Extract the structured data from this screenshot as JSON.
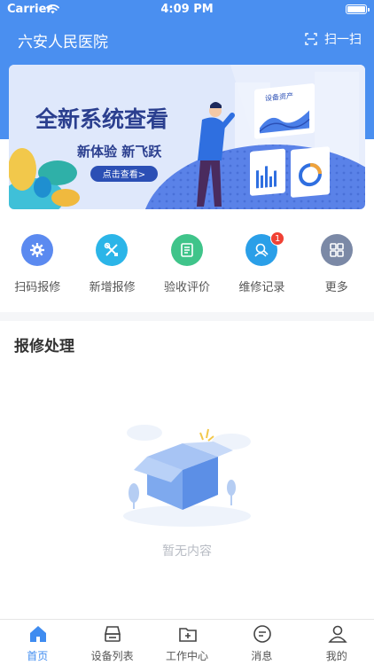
{
  "status_bar": {
    "carrier": "Carrier",
    "time": "4:09 PM"
  },
  "header": {
    "title": "六安人民医院",
    "scan_label": "扫一扫"
  },
  "banner": {
    "headline": "全新系统查看",
    "subline": "新体验 新飞跃",
    "cta_label": "点击查看>",
    "panel_label": "设备资产"
  },
  "shortcuts": [
    {
      "label": "扫码报修",
      "color": "#5b8af0",
      "icon": "gear-icon"
    },
    {
      "label": "新增报修",
      "color": "#2bb5e8",
      "icon": "tools-icon"
    },
    {
      "label": "验收评价",
      "color": "#3fc48a",
      "icon": "document-icon"
    },
    {
      "label": "维修记录",
      "color": "#2a9fe8",
      "icon": "record-icon",
      "badge": "1"
    },
    {
      "label": "更多",
      "color": "#7b89a6",
      "icon": "grid-icon"
    }
  ],
  "section": {
    "title": "报修处理"
  },
  "empty": {
    "text": "暂无内容"
  },
  "tabs": [
    {
      "label": "首页",
      "icon": "home-icon",
      "active": true
    },
    {
      "label": "设备列表",
      "icon": "device-icon",
      "active": false
    },
    {
      "label": "工作中心",
      "icon": "folder-add-icon",
      "active": false
    },
    {
      "label": "消息",
      "icon": "message-icon",
      "active": false
    },
    {
      "label": "我的",
      "icon": "user-icon",
      "active": false
    }
  ],
  "colors": {
    "primary": "#4a8ff0",
    "accent": "#3f8cf0",
    "badge": "#f04134"
  }
}
